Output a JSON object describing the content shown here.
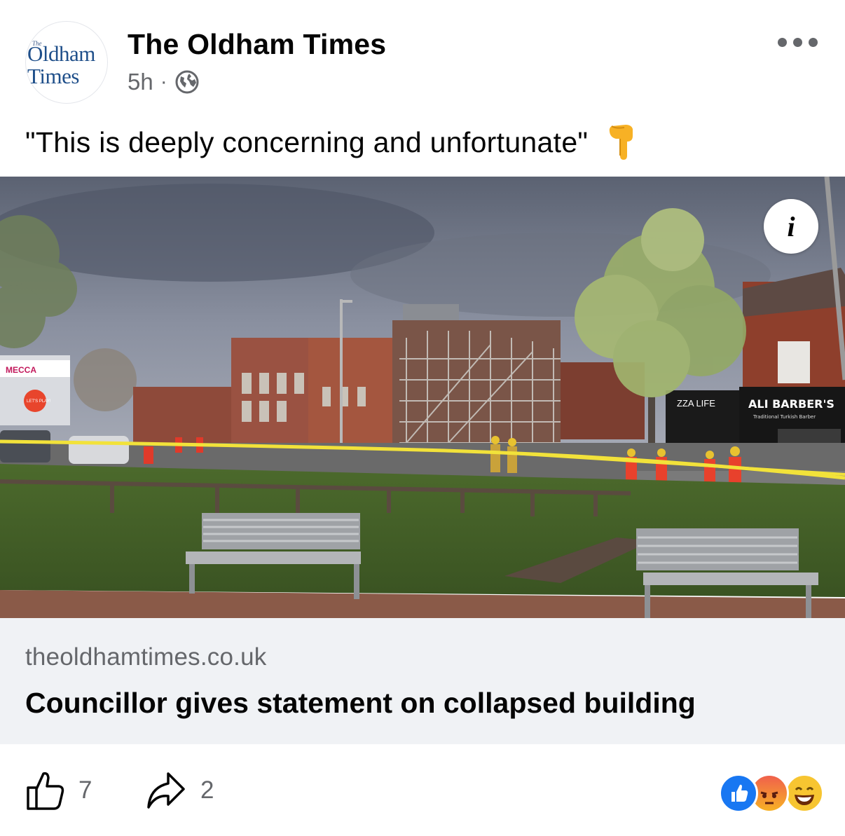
{
  "post": {
    "page_name": "The Oldham Times",
    "timestamp": "5h",
    "separator": "·",
    "audience_icon": "globe-icon",
    "avatar_logo": {
      "small": "The",
      "line1": "Oldham",
      "line2": "Times"
    },
    "more_icon": "more-horizontal-icon",
    "caption": "\"This is deeply concerning and unfortunate\"",
    "caption_emoji": "pointing-down-emoji"
  },
  "photo": {
    "info_glyph": "i",
    "signs": {
      "mecca": "MECCA",
      "lets_play": "LET'S PLAY!",
      "pizza": "ZZA LIFE",
      "barber": "ALI BARBER'S",
      "barber_sub": "Traditional Turkish Barber"
    }
  },
  "link_preview": {
    "domain": "theoldhamtimes.co.uk",
    "title": "Councillor gives statement on collapsed building"
  },
  "footer": {
    "likes": "7",
    "shares": "2",
    "reactions": [
      "like",
      "angry",
      "haha"
    ]
  },
  "colors": {
    "brand_blue": "#1877f2",
    "secondary_text": "#65676b",
    "link_bg": "#f0f2f5"
  }
}
